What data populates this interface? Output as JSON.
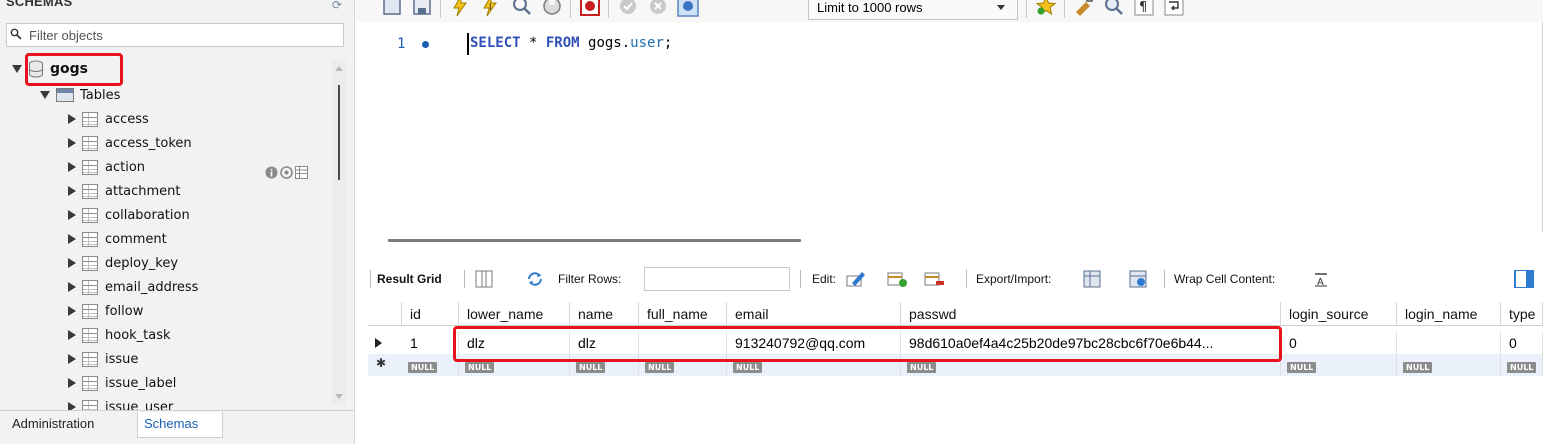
{
  "sidebar": {
    "header": "SCHEMAS",
    "filter_placeholder": "Filter objects",
    "schema": "gogs",
    "tables_label": "Tables",
    "tables": [
      "access",
      "access_token",
      "action",
      "attachment",
      "collaboration",
      "comment",
      "deploy_key",
      "email_address",
      "follow",
      "hook_task",
      "issue",
      "issue_label",
      "issue_user"
    ],
    "bottom_tabs": [
      "Administration",
      "Schemas"
    ]
  },
  "toolbar": {
    "limit": "Limit to 1000 rows"
  },
  "editor": {
    "line_number": "1",
    "sql_keyword_select": "SELECT",
    "sql_star": " * ",
    "sql_keyword_from": "FROM",
    "sql_schema": " gogs.",
    "sql_table": "user",
    "sql_end": ";"
  },
  "result_toolbar": {
    "result_grid": "Result Grid",
    "filter_rows": "Filter Rows:",
    "edit": "Edit:",
    "export_import": "Export/Import:",
    "wrap_cell": "Wrap Cell Content:"
  },
  "grid": {
    "columns": [
      "id",
      "lower_name",
      "name",
      "full_name",
      "email",
      "passwd",
      "login_source",
      "login_name",
      "type"
    ],
    "rows": [
      [
        "1",
        "dlz",
        "dlz",
        "",
        "913240792@qq.com",
        "98d610a0ef4a4c25b20de97bc28cbc6f70e6b44...",
        "0",
        "",
        "0"
      ],
      [
        "NULL",
        "NULL",
        "NULL",
        "NULL",
        "NULL",
        "NULL",
        "NULL",
        "NULL",
        "NULL"
      ]
    ]
  },
  "colors": {
    "highlight": "#e8121c",
    "keyword": "#2f4fb8",
    "selected_tab": "#1a5fb4"
  }
}
